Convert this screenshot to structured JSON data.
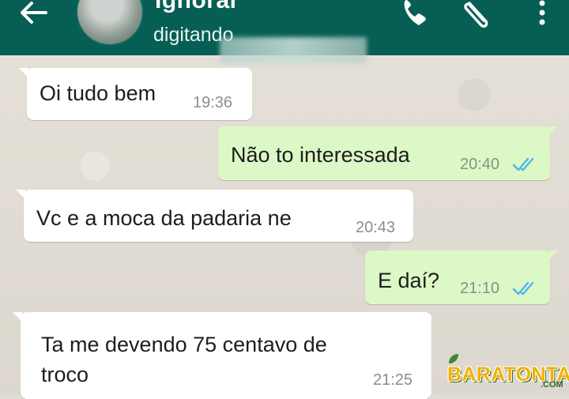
{
  "header": {
    "contact_name": "Ignorar",
    "status": "digitando",
    "background_color": "#075e54",
    "icons": [
      "back-arrow-icon",
      "phone-icon",
      "paperclip-icon",
      "more-vertical-icon"
    ]
  },
  "messages": [
    {
      "direction": "incoming",
      "text": "Oi tudo bem",
      "time": "19:36"
    },
    {
      "direction": "outgoing",
      "text": "Não to interessada",
      "time": "20:40",
      "status": "read"
    },
    {
      "direction": "incoming",
      "text": "Vc e a moca da padaria ne",
      "time": "20:43"
    },
    {
      "direction": "outgoing",
      "text": "E daí?",
      "time": "21:10",
      "status": "read"
    },
    {
      "direction": "incoming",
      "text": "Ta me devendo 75 centavo de troco",
      "time": "21:25"
    }
  ],
  "colors": {
    "incoming_bubble": "#ffffff",
    "outgoing_bubble": "#dcf8c6",
    "read_ticks": "#4fb6ec"
  },
  "watermark": {
    "text": "BARATONTA",
    "suffix": ".COM"
  }
}
